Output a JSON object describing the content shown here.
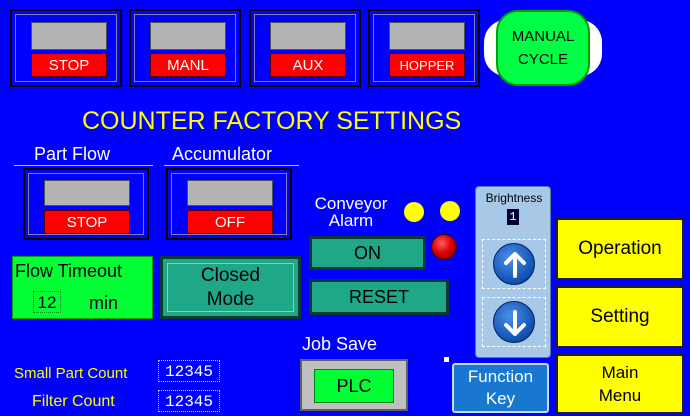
{
  "top_status": [
    {
      "label": "STOP"
    },
    {
      "label": "MANL"
    },
    {
      "label": "AUX"
    },
    {
      "label": "HOPPER"
    }
  ],
  "manual_cycle": {
    "line1": "MANUAL",
    "line2": "CYCLE"
  },
  "title": "COUNTER FACTORY SETTINGS",
  "part_flow": {
    "title": "Part Flow",
    "status": "STOP"
  },
  "accumulator": {
    "title": "Accumulator",
    "status": "OFF"
  },
  "flow_timeout": {
    "label": "Flow Timeout",
    "value": "12",
    "unit": "min"
  },
  "closed_mode": {
    "line1": "Closed",
    "line2": "Mode"
  },
  "conveyor_alarm": {
    "line1": "Conveyor",
    "line2": "Alarm",
    "on_label": "ON",
    "reset_label": "RESET"
  },
  "brightness": {
    "label": "Brightness",
    "value": "1"
  },
  "job_save": {
    "label": "Job Save",
    "plc_label": "PLC"
  },
  "function_key": {
    "line1": "Function",
    "line2": "Key"
  },
  "nav": {
    "operation": "Operation",
    "setting": "Setting",
    "main_menu_line1": "Main",
    "main_menu_line2": "Menu"
  },
  "counts": {
    "small_part_label": "Small Part Count",
    "small_part_value": "12345",
    "filter_label": "Filter Count",
    "filter_value": "12345"
  },
  "colors": {
    "background": "#0000ff",
    "title": "#ffff00",
    "indicator_red": "#ff0000",
    "button_green": "#00ff33"
  }
}
